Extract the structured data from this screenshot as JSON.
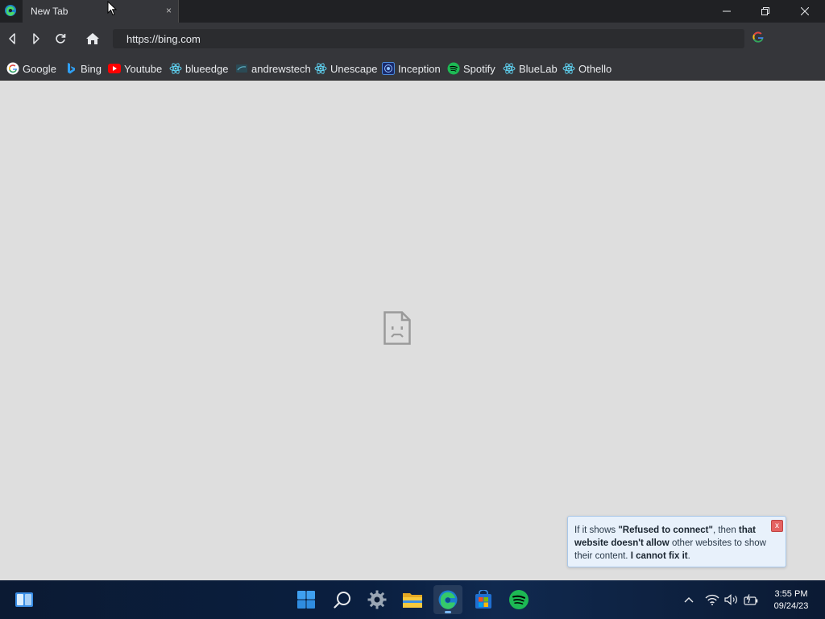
{
  "tab": {
    "title": "New Tab",
    "close_glyph": "×"
  },
  "window_controls": [
    "minimize-icon",
    "restore-icon",
    "close-icon"
  ],
  "nav": {
    "url": "https://bing.com"
  },
  "bookmarks": [
    {
      "label": "Google",
      "icon": "google-icon"
    },
    {
      "label": "Bing",
      "icon": "bing-icon"
    },
    {
      "label": "Youtube",
      "icon": "youtube-icon"
    },
    {
      "label": "blueedge",
      "icon": "react-icon"
    },
    {
      "label": "andrewstech",
      "icon": "andrewstech-icon"
    },
    {
      "label": "Unescape",
      "icon": "react-icon"
    },
    {
      "label": "Inception",
      "icon": "inception-icon"
    },
    {
      "label": "Spotify",
      "icon": "spotify-icon"
    },
    {
      "label": "BlueLab",
      "icon": "react-icon"
    },
    {
      "label": "Othello",
      "icon": "react-icon"
    }
  ],
  "toast": {
    "part1": "If it shows ",
    "part2": "\"Refused to connect\"",
    "part3": ", then ",
    "part4": "that website doesn't allow",
    "part5": " other websites to show their content. ",
    "part6": "I cannot fix it",
    "part7": ".",
    "close_label": "x"
  },
  "taskbar": {
    "apps": [
      "widgets-icon",
      "start-icon",
      "search-icon",
      "settings-icon",
      "file-explorer-icon",
      "edge-icon",
      "store-icon",
      "spotify-icon"
    ],
    "active_app": "edge-icon"
  },
  "clock": {
    "time": "3:55 PM",
    "date": "09/24/23"
  },
  "colors": {
    "accent": "#1DB954",
    "toast_bg": "#e8f1fb",
    "titlebar": "#202124"
  }
}
